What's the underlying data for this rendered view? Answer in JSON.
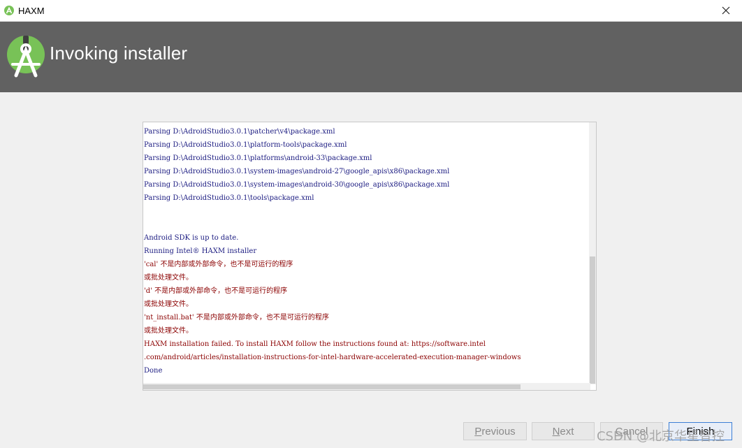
{
  "window": {
    "title": "HAXM",
    "icon": "android-studio-icon"
  },
  "header": {
    "title": "Invoking installer",
    "icon": "android-studio-logo"
  },
  "console": {
    "lines": [
      {
        "text": "Parsing D:\\AdroidStudio3.0.1\\patcher\\v4\\package.xml",
        "type": "info"
      },
      {
        "text": "Parsing D:\\AdroidStudio3.0.1\\platform-tools\\package.xml",
        "type": "info"
      },
      {
        "text": "Parsing D:\\AdroidStudio3.0.1\\platforms\\android-33\\package.xml",
        "type": "info"
      },
      {
        "text": "Parsing D:\\AdroidStudio3.0.1\\system-images\\android-27\\google_apis\\x86\\package.xml",
        "type": "info"
      },
      {
        "text": "Parsing D:\\AdroidStudio3.0.1\\system-images\\android-30\\google_apis\\x86\\package.xml",
        "type": "info"
      },
      {
        "text": "Parsing D:\\AdroidStudio3.0.1\\tools\\package.xml",
        "type": "info"
      },
      {
        "text": "",
        "type": "info"
      },
      {
        "text": "",
        "type": "info"
      },
      {
        "text": "Android SDK is up to date.",
        "type": "info"
      },
      {
        "text": "Running Intel® HAXM installer",
        "type": "info"
      },
      {
        "text": "'cal' 不是内部或外部命令，也不是可运行的程序",
        "type": "error"
      },
      {
        "text": "或批处理文件。",
        "type": "error"
      },
      {
        "text": "'d' 不是内部或外部命令，也不是可运行的程序",
        "type": "error"
      },
      {
        "text": "或批处理文件。",
        "type": "error"
      },
      {
        "text": "'nt_install.bat' 不是内部或外部命令，也不是可运行的程序",
        "type": "error"
      },
      {
        "text": "或批处理文件。",
        "type": "error"
      },
      {
        "text": "HAXM installation failed. To install HAXM follow the instructions found at: https://software.intel",
        "type": "error"
      },
      {
        "text": " .com/android/articles/installation-instructions-for-intel-hardware-accelerated-execution-manager-windows",
        "type": "error"
      },
      {
        "text": "Done",
        "type": "info"
      }
    ]
  },
  "buttons": {
    "previous": "Previous",
    "next": "Next",
    "cancel": "Cancel",
    "finish": "Finish"
  },
  "watermark": "CSDN @北京华星智控",
  "colors": {
    "header_bg": "#616161",
    "info_text": "#1a1a80",
    "error_text": "#8b0000",
    "android_green": "#78c257"
  }
}
